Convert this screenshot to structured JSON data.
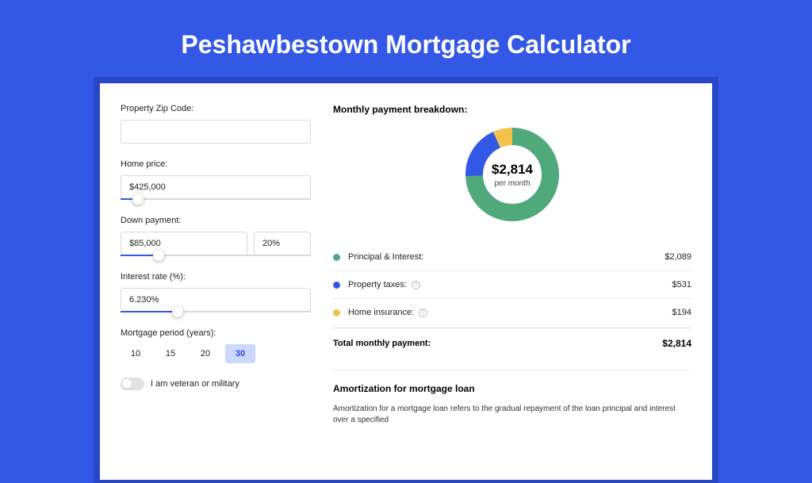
{
  "title": "Peshawbestown Mortgage Calculator",
  "form": {
    "zip_label": "Property Zip Code:",
    "zip_value": "",
    "home_price_label": "Home price:",
    "home_price_value": "$425,000",
    "home_price_pct": 9,
    "down_payment_label": "Down payment:",
    "down_payment_value": "$85,000",
    "down_payment_pct_value": "20%",
    "down_payment_track_pct": 20,
    "rate_label": "Interest rate (%):",
    "rate_value": "6.230%",
    "rate_track_pct": 30,
    "period_label": "Mortgage period (years):",
    "periods": [
      "10",
      "15",
      "20",
      "30"
    ],
    "period_active": "30",
    "veteran_label": "I am veteran or military"
  },
  "breakdown": {
    "title": "Monthly payment breakdown:",
    "amount": "$2,814",
    "sub": "per month",
    "rows": [
      {
        "color": "#4fa97a",
        "label": "Principal & Interest:",
        "value": "$2,089",
        "info": false
      },
      {
        "color": "#3358e6",
        "label": "Property taxes:",
        "value": "$531",
        "info": true
      },
      {
        "color": "#f2c24b",
        "label": "Home insurance:",
        "value": "$194",
        "info": true
      }
    ],
    "total_label": "Total monthly payment:",
    "total_value": "$2,814"
  },
  "amort": {
    "title": "Amortization for mortgage loan",
    "text": "Amortization for a mortgage loan refers to the gradual repayment of the loan principal and interest over a specified"
  },
  "chart_data": {
    "type": "pie",
    "title": "Monthly payment breakdown",
    "series": [
      {
        "name": "Principal & Interest",
        "value": 2089,
        "color": "#4fa97a"
      },
      {
        "name": "Property taxes",
        "value": 531,
        "color": "#3358e6"
      },
      {
        "name": "Home insurance",
        "value": 194,
        "color": "#f2c24b"
      }
    ],
    "total": 2814
  }
}
